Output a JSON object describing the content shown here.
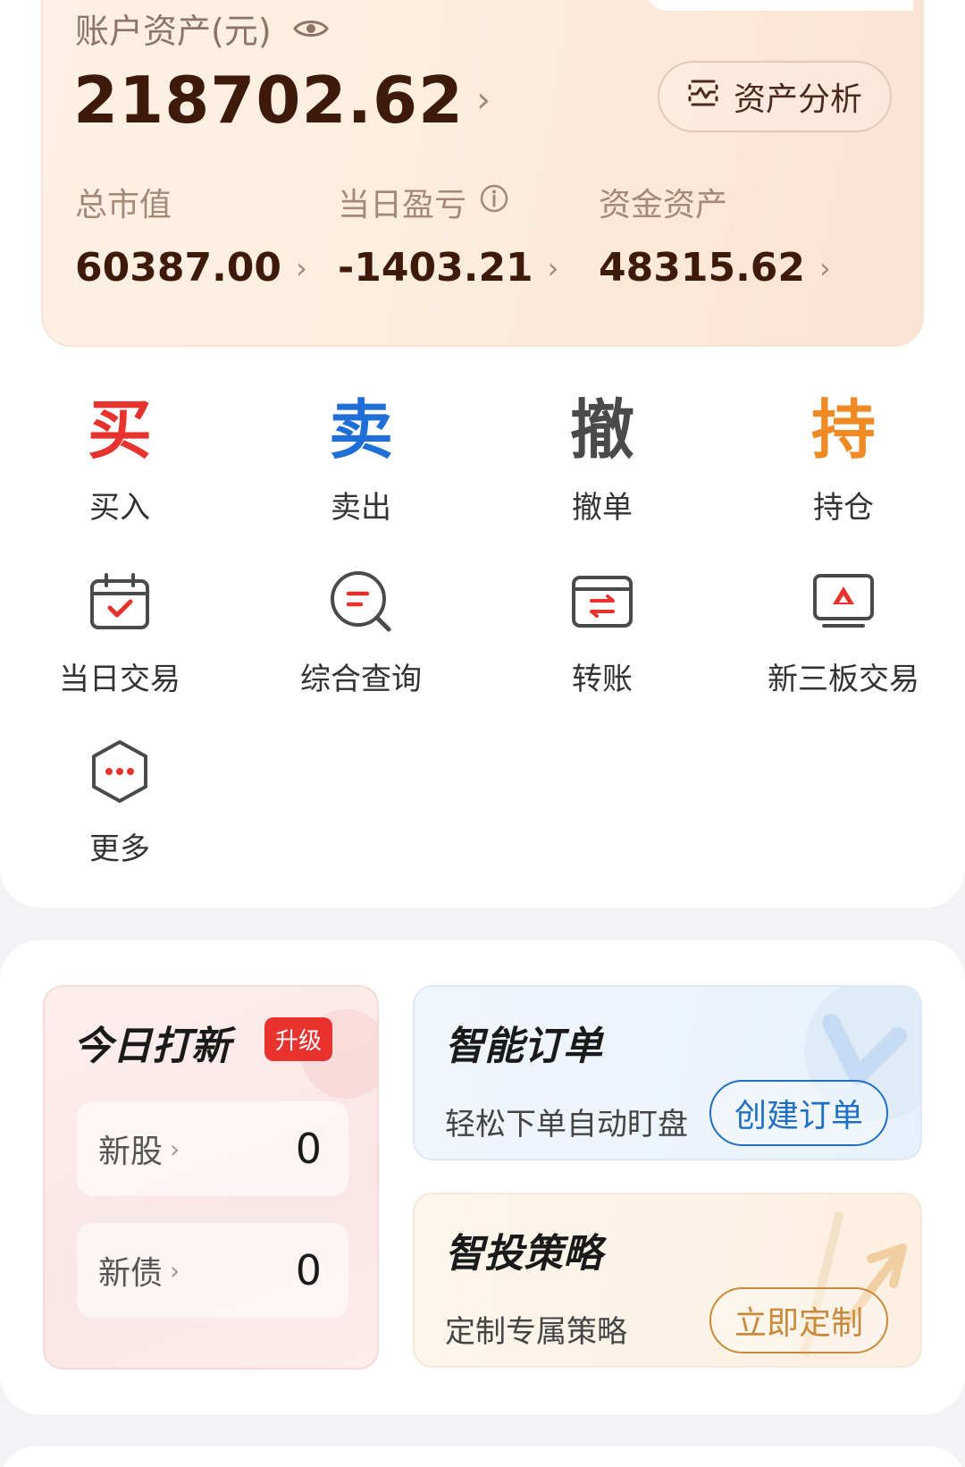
{
  "account": {
    "title": "账户资产(元)",
    "total": "218702.62",
    "analysis_label": "资产分析",
    "stats": [
      {
        "label": "总市值",
        "value": "60387.00"
      },
      {
        "label": "当日盈亏",
        "value": "-1403.21"
      },
      {
        "label": "资金资产",
        "value": "48315.62"
      }
    ]
  },
  "trade_actions": [
    {
      "glyph": "买",
      "label": "买入",
      "color": "#e8322e"
    },
    {
      "glyph": "卖",
      "label": "卖出",
      "color": "#1f6fd6"
    },
    {
      "glyph": "撤",
      "label": "撤单",
      "color": "#4a4a4a"
    },
    {
      "glyph": "持",
      "label": "持仓",
      "color": "#f08a24"
    }
  ],
  "tools": [
    {
      "label": "当日交易",
      "icon": "calendar-check-icon"
    },
    {
      "label": "综合查询",
      "icon": "search-query-icon"
    },
    {
      "label": "转账",
      "icon": "transfer-icon"
    },
    {
      "label": "新三板交易",
      "icon": "new-third-board-icon"
    },
    {
      "label": "更多",
      "icon": "more-icon"
    }
  ],
  "ipo": {
    "title": "今日打新",
    "badge": "升级",
    "rows": [
      {
        "name": "新股",
        "count": "0"
      },
      {
        "name": "新债",
        "count": "0"
      }
    ]
  },
  "smart_order": {
    "title": "智能订单",
    "subtitle": "轻松下单自动盯盘",
    "button": "创建订单"
  },
  "smart_strategy": {
    "title": "智投策略",
    "subtitle": "定制专属策略",
    "button": "立即定制"
  },
  "colors": {
    "accent_red": "#e8322e",
    "accent_blue": "#1f6fc4",
    "accent_gold": "#c98a3a",
    "amount_brown": "#3d1a0a"
  }
}
